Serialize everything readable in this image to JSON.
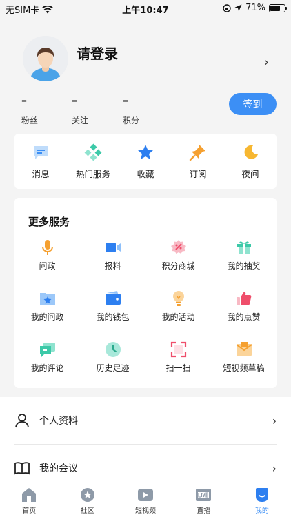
{
  "status_bar": {
    "carrier": "无SIM卡",
    "time": "上午10:47",
    "battery": "71%",
    "battery_level": 0.71
  },
  "profile": {
    "login_prompt": "请登录",
    "stats": [
      {
        "value": "–",
        "label": "粉丝"
      },
      {
        "value": "–",
        "label": "关注"
      },
      {
        "value": "–",
        "label": "积分"
      }
    ],
    "signin_label": "签到"
  },
  "quick_actions": [
    {
      "label": "消息",
      "icon": "message-icon"
    },
    {
      "label": "热门服务",
      "icon": "hot-service-icon"
    },
    {
      "label": "收藏",
      "icon": "star-icon"
    },
    {
      "label": "订阅",
      "icon": "pin-icon"
    },
    {
      "label": "夜间",
      "icon": "moon-icon"
    }
  ],
  "more_services": {
    "title": "更多服务",
    "items": [
      {
        "label": "问政",
        "icon": "microphone-icon"
      },
      {
        "label": "报料",
        "icon": "video-camera-icon"
      },
      {
        "label": "积分商城",
        "icon": "points-mall-icon"
      },
      {
        "label": "我的抽奖",
        "icon": "gift-icon"
      },
      {
        "label": "我的问政",
        "icon": "star-folder-icon"
      },
      {
        "label": "我的钱包",
        "icon": "wallet-icon"
      },
      {
        "label": "我的活动",
        "icon": "lightbulb-icon"
      },
      {
        "label": "我的点赞",
        "icon": "thumbs-up-icon"
      },
      {
        "label": "我的评论",
        "icon": "comment-icon"
      },
      {
        "label": "历史足迹",
        "icon": "clock-icon"
      },
      {
        "label": "扫一扫",
        "icon": "scan-icon"
      },
      {
        "label": "短视频草稿",
        "icon": "draft-envelope-icon"
      }
    ]
  },
  "list": [
    {
      "label": "个人资料",
      "icon": "person-icon"
    },
    {
      "label": "我的会议",
      "icon": "book-icon"
    }
  ],
  "tabs": [
    {
      "label": "首页",
      "icon": "home-icon"
    },
    {
      "label": "社区",
      "icon": "community-icon"
    },
    {
      "label": "短视频",
      "icon": "short-video-icon"
    },
    {
      "label": "直播",
      "icon": "live-icon"
    },
    {
      "label": "我的",
      "icon": "mine-icon",
      "active": true
    }
  ],
  "colors": {
    "accent": "#3c8ff5",
    "background": "#f4f4f4"
  }
}
